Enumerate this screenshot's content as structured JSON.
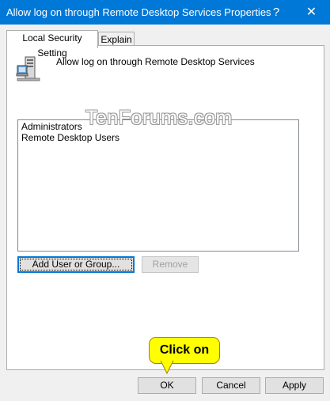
{
  "window": {
    "title": "Allow log on through Remote Desktop Services Properties",
    "help_glyph": "?",
    "close_glyph": "✕"
  },
  "tabs": [
    {
      "label": "Local Security Setting",
      "active": true
    },
    {
      "label": "Explain",
      "active": false
    }
  ],
  "policy": {
    "name": "Allow log on through Remote Desktop Services",
    "icon": "computer-policy-icon"
  },
  "members": [
    "Administrators",
    "Remote Desktop Users"
  ],
  "watermark": "TenForums.com",
  "actions": {
    "add_label": "Add User or Group...",
    "remove_label": "Remove"
  },
  "footer": {
    "ok_label": "OK",
    "cancel_label": "Cancel",
    "apply_label": "Apply"
  },
  "callout": {
    "text": "Click on",
    "color": "#ffff00"
  },
  "colors": {
    "titlebar": "#0078d7",
    "accent": "#0078d7",
    "dialog_bg": "#f0f0f0"
  }
}
